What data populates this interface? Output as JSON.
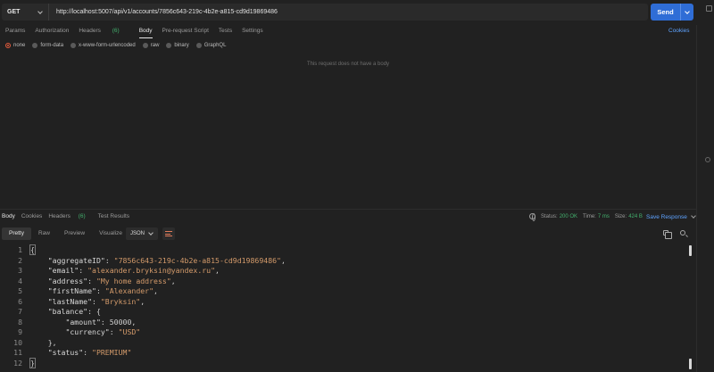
{
  "request": {
    "method": "GET",
    "url": "http://localhost:5007/api/v1/accounts/7856c643-219c-4b2e-a815-cd9d19869486",
    "send_label": "Send"
  },
  "request_tabs": {
    "params": "Params",
    "authorization": "Authorization",
    "headers": "Headers",
    "headers_count": "(6)",
    "body": "Body",
    "prerequest": "Pre-request Script",
    "tests": "Tests",
    "settings": "Settings",
    "cookies": "Cookies"
  },
  "body_types": [
    "none",
    "form-data",
    "x-www-form-urlencoded",
    "raw",
    "binary",
    "GraphQL"
  ],
  "no_body_text": "This request does not have a body",
  "response_tabs": {
    "body": "Body",
    "cookies": "Cookies",
    "headers": "Headers",
    "headers_count": "(6)",
    "test_results": "Test Results"
  },
  "response_meta": {
    "status_label": "Status:",
    "status_value": "200 OK",
    "time_label": "Time:",
    "time_value": "7 ms",
    "size_label": "Size:",
    "size_value": "424 B",
    "save_response": "Save Response"
  },
  "view_tabs": [
    "Pretty",
    "Raw",
    "Preview",
    "Visualize"
  ],
  "format": "JSON",
  "response_body": {
    "lines": [
      {
        "n": "1",
        "t": "{"
      },
      {
        "n": "2",
        "t": "    \"aggregateID\": \"7856c643-219c-4b2e-a815-cd9d19869486\","
      },
      {
        "n": "3",
        "t": "    \"email\": \"alexander.bryksin@yandex.ru\","
      },
      {
        "n": "4",
        "t": "    \"address\": \"My home address\","
      },
      {
        "n": "5",
        "t": "    \"firstName\": \"Alexander\","
      },
      {
        "n": "6",
        "t": "    \"lastName\": \"Bryksin\","
      },
      {
        "n": "7",
        "t": "    \"balance\": {"
      },
      {
        "n": "8",
        "t": "        \"amount\": 50000,"
      },
      {
        "n": "9",
        "t": "        \"currency\": \"USD\""
      },
      {
        "n": "10",
        "t": "    },"
      },
      {
        "n": "11",
        "t": "    \"status\": \"PREMIUM\""
      },
      {
        "n": "12",
        "t": "}"
      }
    ]
  }
}
